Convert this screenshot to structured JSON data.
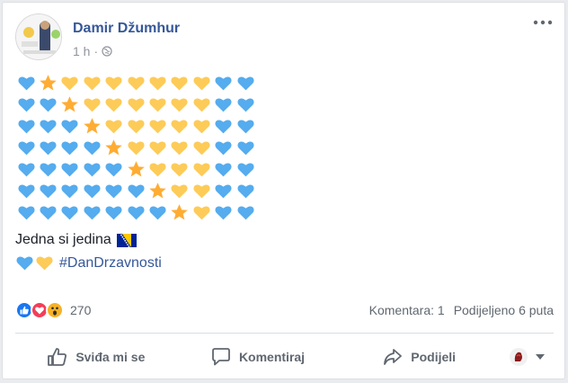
{
  "post": {
    "author": "Damir Džumhur",
    "time": "1 h",
    "time_separator": "·",
    "privacy_icon": "globe-icon",
    "more_icon": "more-horizontal-icon",
    "emoji_rows": [
      [
        "blue",
        "star",
        "yellow",
        "yellow",
        "yellow",
        "yellow",
        "yellow",
        "yellow",
        "yellow",
        "blue",
        "blue"
      ],
      [
        "blue",
        "blue",
        "star",
        "yellow",
        "yellow",
        "yellow",
        "yellow",
        "yellow",
        "yellow",
        "blue",
        "blue"
      ],
      [
        "blue",
        "blue",
        "blue",
        "star",
        "yellow",
        "yellow",
        "yellow",
        "yellow",
        "yellow",
        "blue",
        "blue"
      ],
      [
        "blue",
        "blue",
        "blue",
        "blue",
        "star",
        "yellow",
        "yellow",
        "yellow",
        "yellow",
        "blue",
        "blue"
      ],
      [
        "blue",
        "blue",
        "blue",
        "blue",
        "blue",
        "star",
        "yellow",
        "yellow",
        "yellow",
        "blue",
        "blue"
      ],
      [
        "blue",
        "blue",
        "blue",
        "blue",
        "blue",
        "blue",
        "star",
        "yellow",
        "yellow",
        "blue",
        "blue"
      ],
      [
        "blue",
        "blue",
        "blue",
        "blue",
        "blue",
        "blue",
        "blue",
        "star",
        "yellow",
        "blue",
        "blue"
      ]
    ],
    "text": "Jedna si jedina",
    "flag_icon": "bosnia-flag-icon",
    "hashtag_hearts": [
      "blue",
      "yellow"
    ],
    "hashtag": "#DanDrzavnosti"
  },
  "stats": {
    "reactions": [
      "like-reaction-icon",
      "love-reaction-icon",
      "wow-reaction-icon"
    ],
    "reaction_count": "270",
    "comments": "Komentara: 1",
    "shares": "Podijeljeno 6 puta"
  },
  "actions": {
    "like": "Sviđa mi se",
    "comment": "Komentiraj",
    "share": "Podijeli"
  },
  "colors": {
    "blue_heart": "#55acee",
    "yellow_heart": "#fdcb58",
    "star": "#ffac33",
    "link": "#365899",
    "muted": "#90949c",
    "like_blue": "#1877f2",
    "love_red": "#f33e58",
    "wow_yellow": "#f7b125"
  }
}
